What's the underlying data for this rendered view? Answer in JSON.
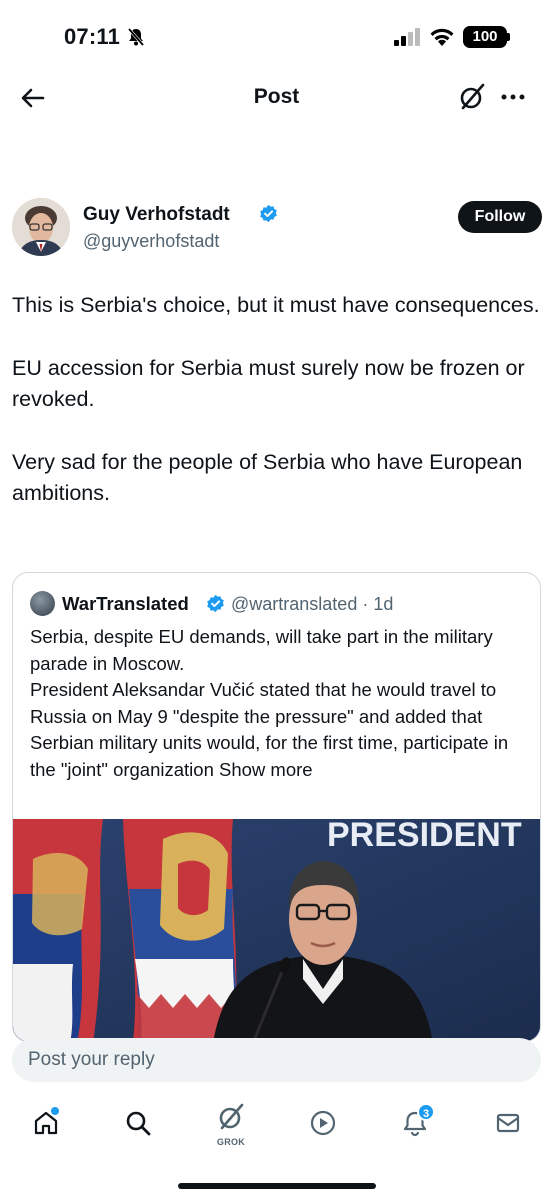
{
  "status_bar": {
    "time": "07:11",
    "battery": "100"
  },
  "header": {
    "title": "Post"
  },
  "post": {
    "author_name": "Guy Verhofstadt",
    "author_handle": "@guyverhofstadt",
    "follow_label": "Follow",
    "paragraphs": [
      "This is Serbia's choice, but it must have consequences.",
      "EU accession for Serbia must surely now be frozen or revoked.",
      "Very sad for the people of Serbia who have European ambitions."
    ]
  },
  "quote": {
    "author_name": "WarTranslated",
    "author_handle_time": "@wartranslated · 1d",
    "text_line1": "Serbia, despite EU demands, will take part in the military parade in Moscow.",
    "text_line2": "President Aleksandar Vučić stated that he would travel to Russia on May 9 \"despite the pressure\" and added that Serbian military units would, for the first time, participate in the \"joint\" organization",
    "show_more": "Show more",
    "image_text": "PRESIDENT"
  },
  "reply": {
    "placeholder": "Post your reply"
  },
  "bottom_nav": {
    "grok_label": "GROK",
    "notifications_count": "3"
  },
  "colors": {
    "accent": "#1d9bf0",
    "text": "#0f1419",
    "secondary_text": "#536471",
    "border": "#cfd9de"
  }
}
